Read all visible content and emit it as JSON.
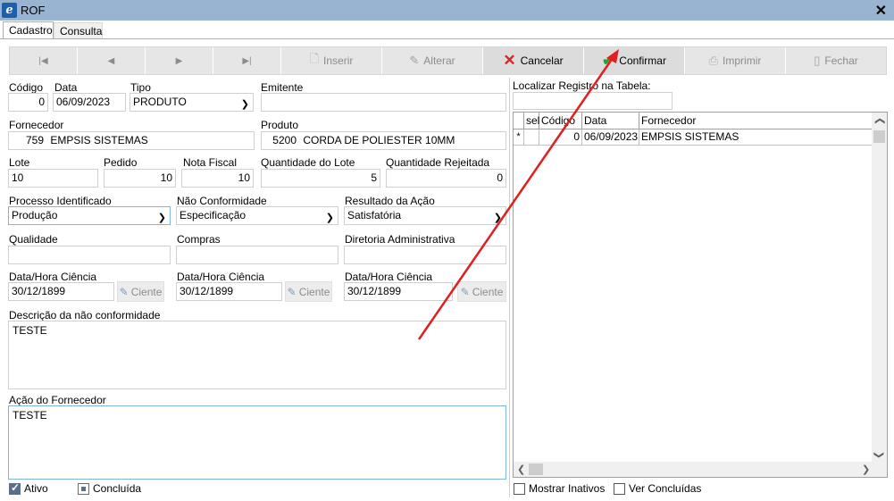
{
  "window": {
    "title": "ROF",
    "app_icon_letter": "e"
  },
  "tabs": [
    {
      "label": "Cadastro"
    },
    {
      "label": "Consulta"
    }
  ],
  "toolbar": {
    "first": "|◀",
    "prev": "◀",
    "next": "▶",
    "last": "▶|",
    "inserir": "Inserir",
    "alterar": "Alterar",
    "cancelar": "Cancelar",
    "confirmar": "Confirmar",
    "imprimir": "Imprimir",
    "fechar": "Fechar"
  },
  "form": {
    "codigo": {
      "label": "Código",
      "value": "0"
    },
    "data": {
      "label": "Data",
      "value": "06/09/2023"
    },
    "tipo": {
      "label": "Tipo",
      "value": "PRODUTO"
    },
    "emitente": {
      "label": "Emitente",
      "value": ""
    },
    "fornecedor": {
      "label": "Fornecedor",
      "code": "759",
      "name": "EMPSIS SISTEMAS"
    },
    "produto": {
      "label": "Produto",
      "code": "5200",
      "name": "CORDA DE POLIESTER 10MM"
    },
    "lote": {
      "label": "Lote",
      "value": "10"
    },
    "pedido": {
      "label": "Pedido",
      "value": "10"
    },
    "nota_fiscal": {
      "label": "Nota Fiscal",
      "value": "10"
    },
    "qtd_lote": {
      "label": "Quantidade do Lote",
      "value": "5"
    },
    "qtd_rejeitada": {
      "label": "Quantidade Rejeitada",
      "value": "0"
    },
    "processo": {
      "label": "Processo Identificado",
      "value": "Produção"
    },
    "nao_conformidade": {
      "label": "Não Conformidade",
      "value": "Especificação"
    },
    "resultado": {
      "label": "Resultado da Ação",
      "value": "Satisfatória"
    },
    "qualidade": {
      "label": "Qualidade",
      "value": ""
    },
    "compras": {
      "label": "Compras",
      "value": ""
    },
    "diretoria": {
      "label": "Diretoria Administrativa",
      "value": ""
    },
    "ciencia1": {
      "label": "Data/Hora Ciência",
      "value": "30/12/1899",
      "button": "Ciente"
    },
    "ciencia2": {
      "label": "Data/Hora Ciência",
      "value": "30/12/1899",
      "button": "Ciente"
    },
    "ciencia3": {
      "label": "Data/Hora Ciência",
      "value": "30/12/1899",
      "button": "Ciente"
    },
    "descricao": {
      "label": "Descrição da não conformidade",
      "value": "TESTE"
    },
    "acao": {
      "label": "Ação do Fornecedor",
      "value": "TESTE"
    },
    "ativo": {
      "label": "Ativo",
      "checked": true
    },
    "concluida": {
      "label": "Concluída",
      "checked": false
    }
  },
  "right": {
    "search_label": "Localizar Registro na Tabela:",
    "grid": {
      "columns": [
        "sel",
        "Código",
        "Data",
        "Fornecedor"
      ],
      "rows": [
        {
          "marker": "*",
          "sel": "",
          "codigo": "0",
          "data": "06/09/2023",
          "fornecedor": "EMPSIS SISTEMAS"
        }
      ]
    },
    "mostrar_inativos": "Mostrar Inativos",
    "ver_concluidas": "Ver Concluídas"
  },
  "colors": {
    "titlebar": "#99b4d1",
    "annotation_arrow": "#e02020",
    "focus_border": "#7eb4ea"
  }
}
